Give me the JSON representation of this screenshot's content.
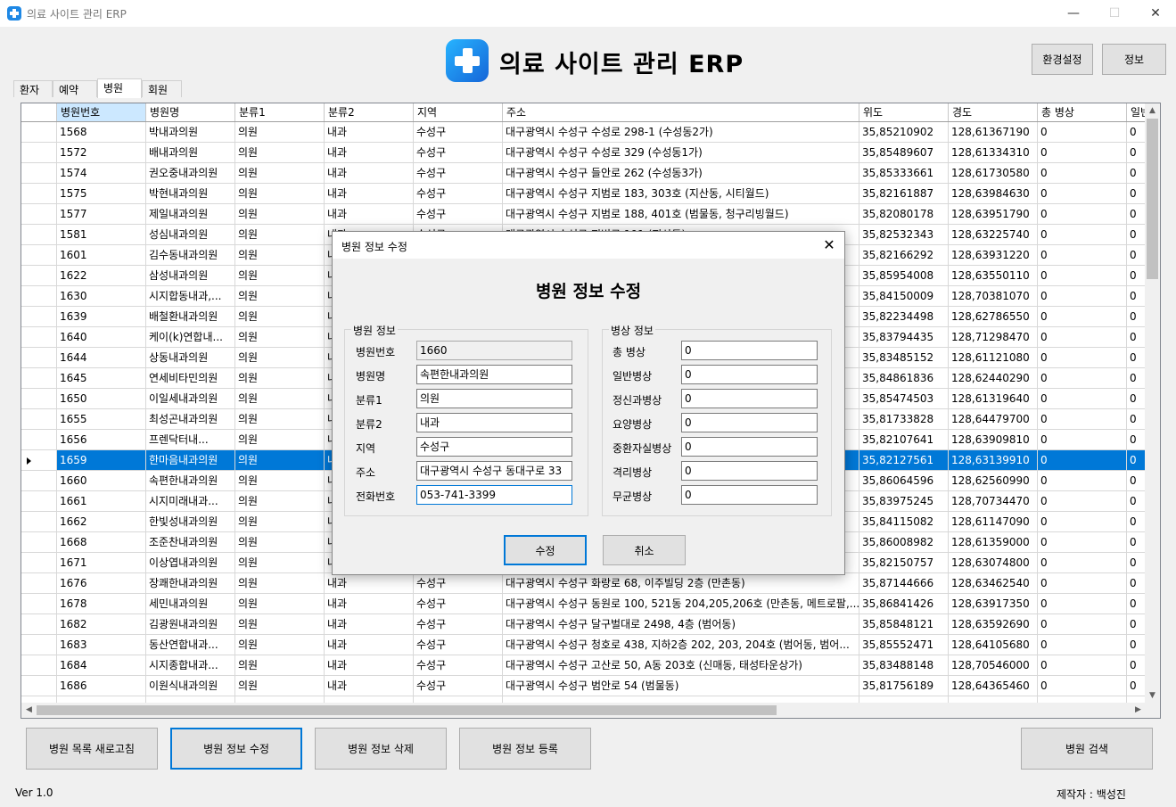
{
  "window": {
    "title": "의료 사이트 관리 ERP",
    "minimize": "—",
    "maximize": "☐",
    "close": "✕"
  },
  "header": {
    "title": "의료 사이트 관리 ERP",
    "settings_button": "환경설정",
    "info_button": "정보"
  },
  "tabs": [
    {
      "label": "환자"
    },
    {
      "label": "예약"
    },
    {
      "label": "병원"
    },
    {
      "label": "회원"
    }
  ],
  "active_tab": "병원",
  "grid": {
    "columns": [
      "병원번호",
      "병원명",
      "분류1",
      "분류2",
      "지역",
      "주소",
      "위도",
      "경도",
      "총 병상",
      "일반"
    ],
    "selected_row_index": 16,
    "rows": [
      [
        "1568",
        "박내과의원",
        "의원",
        "내과",
        "수성구",
        "대구광역시 수성구 수성로 298-1 (수성동2가)",
        "35,85210902",
        "128,61367190",
        "0",
        "0"
      ],
      [
        "1572",
        "배내과의원",
        "의원",
        "내과",
        "수성구",
        "대구광역시 수성구 수성로 329 (수성동1가)",
        "35,85489607",
        "128,61334310",
        "0",
        "0"
      ],
      [
        "1574",
        "권오중내과의원",
        "의원",
        "내과",
        "수성구",
        "대구광역시 수성구 들안로 262 (수성동3가)",
        "35,85333661",
        "128,61730580",
        "0",
        "0"
      ],
      [
        "1575",
        "박현내과의원",
        "의원",
        "내과",
        "수성구",
        "대구광역시 수성구 지범로 183, 303호 (지산동, 시티월드)",
        "35,82161887",
        "128,63984630",
        "0",
        "0"
      ],
      [
        "1577",
        "제일내과의원",
        "의원",
        "내과",
        "수성구",
        "대구광역시 수성구 지범로 188, 401호 (범물동, 청구리빙월드)",
        "35,82080178",
        "128,63951790",
        "0",
        "0"
      ],
      [
        "1581",
        "성심내과의원",
        "의원",
        "내과",
        "수성구",
        "대구광역시 수성구 지범로 191 (지산동)",
        "35,82532343",
        "128,63225740",
        "0",
        "0"
      ],
      [
        "1601",
        "김수동내과의원",
        "의원",
        "내과",
        "수성구",
        "",
        "35,82166292",
        "128,63931220",
        "0",
        "0"
      ],
      [
        "1622",
        "삼성내과의원",
        "의원",
        "내과",
        "수성구",
        "",
        "35,85954008",
        "128,63550110",
        "0",
        "0"
      ],
      [
        "1630",
        "시지합동내과,...",
        "의원",
        "내과",
        "수성구",
        "",
        "35,84150009",
        "128,70381070",
        "0",
        "0"
      ],
      [
        "1639",
        "배철환내과의원",
        "의원",
        "내과",
        "수성구",
        "",
        "35,82234498",
        "128,62786550",
        "0",
        "0"
      ],
      [
        "1640",
        "케이(k)연합내...",
        "의원",
        "내과",
        "수성구",
        "",
        "35,83794435",
        "128,71298470",
        "0",
        "0"
      ],
      [
        "1644",
        "상동내과의원",
        "의원",
        "내과",
        "수성구",
        "",
        "35,83485152",
        "128,61121080",
        "0",
        "0"
      ],
      [
        "1645",
        "연세비타민의원",
        "의원",
        "내과",
        "수성구",
        "",
        "35,84861836",
        "128,62440290",
        "0",
        "0"
      ],
      [
        "1650",
        "이일세내과의원",
        "의원",
        "내과",
        "수성구",
        "",
        "35,85474503",
        "128,61319640",
        "0",
        "0"
      ],
      [
        "1655",
        "최성곤내과의원",
        "의원",
        "내과",
        "수성구",
        "",
        "35,81733828",
        "128,64479700",
        "0",
        "0"
      ],
      [
        "1656",
        "프렌닥터내...",
        "의원",
        "내과",
        "수성구",
        "",
        "35,82107641",
        "128,63909810",
        "0",
        "0"
      ],
      [
        "1659",
        "한마음내과의원",
        "의원",
        "내과",
        "수성구",
        "",
        "35,82127561",
        "128,63139910",
        "0",
        "0"
      ],
      [
        "1660",
        "속편한내과의원",
        "의원",
        "내과",
        "수성구",
        "",
        "35,86064596",
        "128,62560990",
        "0",
        "0"
      ],
      [
        "1661",
        "시지미래내과...",
        "의원",
        "내과",
        "수성구",
        "",
        "35,83975245",
        "128,70734470",
        "0",
        "0"
      ],
      [
        "1662",
        "한빛성내과의원",
        "의원",
        "내과",
        "수성구",
        "",
        "35,84115082",
        "128,61147090",
        "0",
        "0"
      ],
      [
        "1668",
        "조준찬내과의원",
        "의원",
        "내과",
        "수성구",
        "",
        "35,86008982",
        "128,61359000",
        "0",
        "0"
      ],
      [
        "1671",
        "이상엽내과의원",
        "의원",
        "내과",
        "수성구",
        "",
        "35,82150757",
        "128,63074800",
        "0",
        "0"
      ],
      [
        "1676",
        "장쾌한내과의원",
        "의원",
        "내과",
        "수성구",
        "대구광역시 수성구 화랑로 68, 이주빌딩 2층 (만촌동)",
        "35,87144666",
        "128,63462540",
        "0",
        "0"
      ],
      [
        "1678",
        "세민내과의원",
        "의원",
        "내과",
        "수성구",
        "대구광역시 수성구 동원로 100, 521동 204,205,206호 (만촌동, 메트로팔,...",
        "35,86841426",
        "128,63917350",
        "0",
        "0"
      ],
      [
        "1682",
        "김광원내과의원",
        "의원",
        "내과",
        "수성구",
        "대구광역시 수성구 달구벌대로 2498, 4층 (범어동)",
        "35,85848121",
        "128,63592690",
        "0",
        "0"
      ],
      [
        "1683",
        "동산연합내과...",
        "의원",
        "내과",
        "수성구",
        "대구광역시 수성구 청호로 438, 지하2층 202, 203, 204호 (범어동, 범어...",
        "35,85552471",
        "128,64105680",
        "0",
        "0"
      ],
      [
        "1684",
        "시지종합내과...",
        "의원",
        "내과",
        "수성구",
        "대구광역시 수성구 고산로 50, A동 203호 (신매동, 태성타운상가)",
        "35,83488148",
        "128,70546000",
        "0",
        "0"
      ],
      [
        "1686",
        "이원식내과의원",
        "의원",
        "내과",
        "수성구",
        "대구광역시 수성구 범안로 54 (범물동)",
        "35,81756189",
        "128,64365460",
        "0",
        "0"
      ],
      [
        "",
        "",
        "",
        "",
        "",
        "",
        "",
        "",
        "",
        ""
      ]
    ]
  },
  "bottom_buttons": {
    "refresh": "병원 목록 새로고침",
    "edit": "병원 정보 수정",
    "delete": "병원 정보 삭제",
    "register": "병원 정보 등록",
    "search": "병원 검색"
  },
  "status": {
    "version": "Ver 1.0",
    "author": "제작자 : 백성진"
  },
  "dialog": {
    "window_title": "병원 정보 수정",
    "close": "✕",
    "heading": "병원 정보 수정",
    "hospital_group_label": "병원 정보",
    "bed_group_label": "병상 정보",
    "hospital_fields": [
      {
        "label": "병원번호",
        "value": "1660"
      },
      {
        "label": "병원명",
        "value": "속편한내과의원"
      },
      {
        "label": "분류1",
        "value": "의원"
      },
      {
        "label": "분류2",
        "value": "내과"
      },
      {
        "label": "지역",
        "value": "수성구"
      },
      {
        "label": "주소",
        "value": "대구광역시 수성구 동대구로 33"
      },
      {
        "label": "전화번호",
        "value": "053-741-3399"
      }
    ],
    "bed_fields": [
      {
        "label": "총 병상",
        "value": "0"
      },
      {
        "label": "일반병상",
        "value": "0"
      },
      {
        "label": "정신과병상",
        "value": "0"
      },
      {
        "label": "요양병상",
        "value": "0"
      },
      {
        "label": "중환자실병상",
        "value": "0"
      },
      {
        "label": "격리병상",
        "value": "0"
      },
      {
        "label": "무균병상",
        "value": "0"
      }
    ],
    "ok_button": "수정",
    "cancel_button": "취소"
  },
  "colors": {
    "selection": "#0078d7",
    "header_selected": "#cce8ff",
    "logo_gradient_start": "#27b4ff",
    "logo_gradient_end": "#1565d8"
  }
}
